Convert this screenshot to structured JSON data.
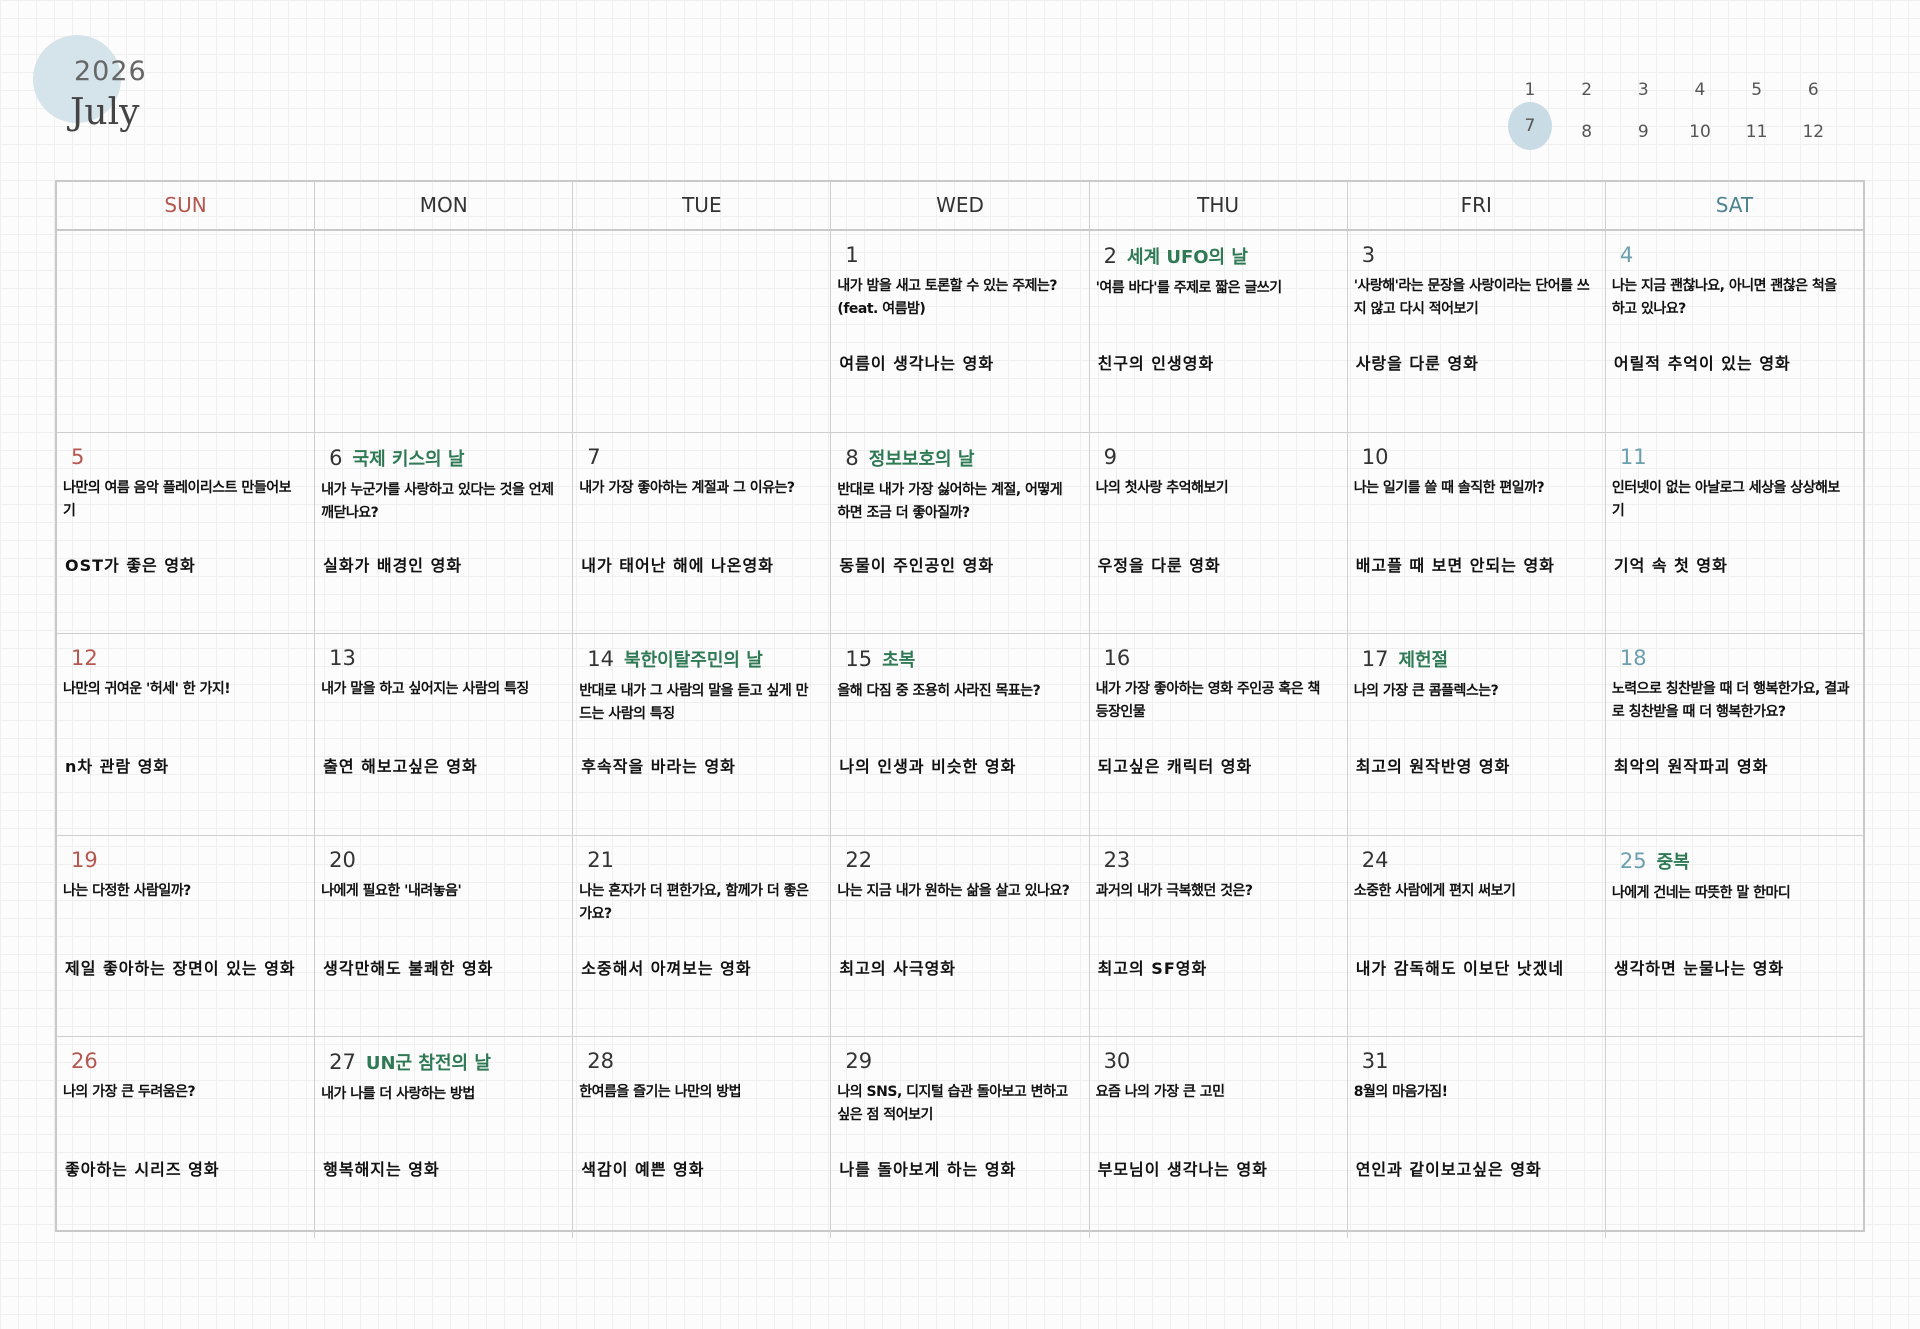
{
  "header": {
    "year": "2026",
    "month": "July",
    "months": [
      [
        "1",
        "2",
        "3",
        "4",
        "5",
        "6"
      ],
      [
        "7",
        "8",
        "9",
        "10",
        "11",
        "12"
      ]
    ],
    "active_month": "7"
  },
  "weekdays": [
    "SUN",
    "MON",
    "TUE",
    "WED",
    "THU",
    "FRI",
    "SAT"
  ],
  "weeks": [
    [
      {
        "num": "",
        "holiday": "",
        "question": "",
        "movie": ""
      },
      {
        "num": "",
        "holiday": "",
        "question": "",
        "movie": ""
      },
      {
        "num": "",
        "holiday": "",
        "question": "",
        "movie": ""
      },
      {
        "num": "1",
        "holiday": "",
        "question": "내가 밤을 새고 토론할 수 있는 주제는?(feat. 여름밤)",
        "movie": "여름이 생각나는 영화"
      },
      {
        "num": "2",
        "holiday": "세계 UFO의 날",
        "question": "'여름 바다'를 주제로 짧은 글쓰기",
        "movie": "친구의 인생영화"
      },
      {
        "num": "3",
        "holiday": "",
        "question": "'사랑해'라는 문장을 사랑이라는 단어를 쓰지 않고 다시 적어보기",
        "movie": "사랑을 다룬 영화"
      },
      {
        "num": "4",
        "holiday": "",
        "question": "나는 지금 괜찮나요, 아니면 괜찮은 척을 하고 있나요?",
        "movie": "어릴적 추억이 있는 영화"
      }
    ],
    [
      {
        "num": "5",
        "holiday": "",
        "question": "나만의 여름 음악 플레이리스트 만들어보기",
        "movie": "OST가 좋은 영화"
      },
      {
        "num": "6",
        "holiday": "국제 키스의 날",
        "question": "내가 누군가를 사랑하고 있다는 것을 언제 깨닫나요?",
        "movie": "실화가 배경인 영화"
      },
      {
        "num": "7",
        "holiday": "",
        "question": "내가 가장 좋아하는 계절과 그 이유는?",
        "movie": "내가 태어난 해에 나온영화"
      },
      {
        "num": "8",
        "holiday": "정보보호의 날",
        "question": "반대로 내가 가장 싫어하는 계절, 어떻게 하면 조금 더 좋아질까?",
        "movie": "동물이 주인공인 영화"
      },
      {
        "num": "9",
        "holiday": "",
        "question": "나의 첫사랑 추억해보기",
        "movie": "우정을 다룬 영화"
      },
      {
        "num": "10",
        "holiday": "",
        "question": "나는 일기를 쓸 때 솔직한 편일까?",
        "movie": "배고플 때 보면 안되는 영화"
      },
      {
        "num": "11",
        "holiday": "",
        "question": "인터넷이 없는 아날로그 세상을 상상해보기",
        "movie": "기억 속 첫 영화"
      }
    ],
    [
      {
        "num": "12",
        "holiday": "",
        "question": "나만의 귀여운 '허세' 한 가지!",
        "movie": "n차 관람 영화"
      },
      {
        "num": "13",
        "holiday": "",
        "question": "내가 말을 하고 싶어지는 사람의 특징",
        "movie": "출연 해보고싶은 영화"
      },
      {
        "num": "14",
        "holiday": "북한이탈주민의 날",
        "question": "반대로 내가 그 사람의 말을 듣고 싶게 만드는 사람의 특징",
        "movie": "후속작을 바라는 영화"
      },
      {
        "num": "15",
        "holiday": "초복",
        "question": "올해 다짐 중 조용히 사라진 목표는?",
        "movie": "나의 인생과 비슷한 영화"
      },
      {
        "num": "16",
        "holiday": "",
        "question": "내가 가장 좋아하는 영화 주인공 혹은 책 등장인물",
        "movie": "되고싶은 캐릭터 영화"
      },
      {
        "num": "17",
        "holiday": "제헌절",
        "question": "나의 가장 큰 콤플렉스는?",
        "movie": "최고의 원작반영 영화"
      },
      {
        "num": "18",
        "holiday": "",
        "question": "노력으로 칭찬받을 때 더 행복한가요, 결과로 칭찬받을 때 더 행복한가요?",
        "movie": "최악의 원작파괴 영화"
      }
    ],
    [
      {
        "num": "19",
        "holiday": "",
        "question": "나는 다정한 사람일까?",
        "movie": "제일 좋아하는 장면이 있는 영화"
      },
      {
        "num": "20",
        "holiday": "",
        "question": "나에게 필요한 '내려놓음'",
        "movie": "생각만해도 불쾌한 영화"
      },
      {
        "num": "21",
        "holiday": "",
        "question": "나는 혼자가 더 편한가요, 함께가 더 좋은가요?",
        "movie": "소중해서 아껴보는 영화"
      },
      {
        "num": "22",
        "holiday": "",
        "question": "나는 지금 내가 원하는 삶을 살고 있나요?",
        "movie": "최고의 사극영화"
      },
      {
        "num": "23",
        "holiday": "",
        "question": "과거의 내가 극복했던 것은?",
        "movie": "최고의 SF영화"
      },
      {
        "num": "24",
        "holiday": "",
        "question": "소중한 사람에게 편지 써보기",
        "movie": "내가 감독해도 이보단 낫겠네"
      },
      {
        "num": "25",
        "holiday": "중복",
        "question": "나에게 건네는 따뜻한 말 한마디",
        "movie": "생각하면 눈물나는 영화"
      }
    ],
    [
      {
        "num": "26",
        "holiday": "",
        "question": "나의 가장 큰 두려움은?",
        "movie": "좋아하는 시리즈 영화"
      },
      {
        "num": "27",
        "holiday": "UN군 참전의 날",
        "question": "내가 나를 더 사랑하는 방법",
        "movie": "행복해지는 영화"
      },
      {
        "num": "28",
        "holiday": "",
        "question": "한여름을 즐기는 나만의 방법",
        "movie": "색감이 예쁜 영화"
      },
      {
        "num": "29",
        "holiday": "",
        "question": "나의 SNS, 디지털 습관 돌아보고 변하고 싶은 점 적어보기",
        "movie": "나를 돌아보게 하는 영화"
      },
      {
        "num": "30",
        "holiday": "",
        "question": "요즘 나의 가장 큰 고민",
        "movie": "부모님이 생각나는 영화"
      },
      {
        "num": "31",
        "holiday": "",
        "question": "8월의 마음가짐!",
        "movie": "연인과 같이보고싶은 영화"
      },
      {
        "num": "",
        "holiday": "",
        "question": "",
        "movie": ""
      }
    ]
  ]
}
